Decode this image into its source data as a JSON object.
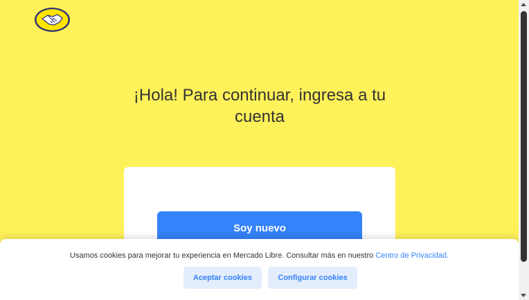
{
  "header": {
    "logo_icon": "handshake-logo-icon"
  },
  "main": {
    "heading": "¡Hola! Para continuar, ingresa a tu cuenta",
    "primary_button_label": "Soy nuevo"
  },
  "cookie_banner": {
    "text": "Usamos cookies para mejorar tu experiencia en Mercado Libre. Consultar más en nuestro ",
    "link_text": "Centro de Privacidad.",
    "accept_label": "Aceptar cookies",
    "configure_label": "Configurar cookies"
  },
  "colors": {
    "page_background": "#fff159",
    "primary_blue": "#3483fa",
    "secondary_button_bg": "#e3edfb",
    "text_dark": "#333333"
  }
}
